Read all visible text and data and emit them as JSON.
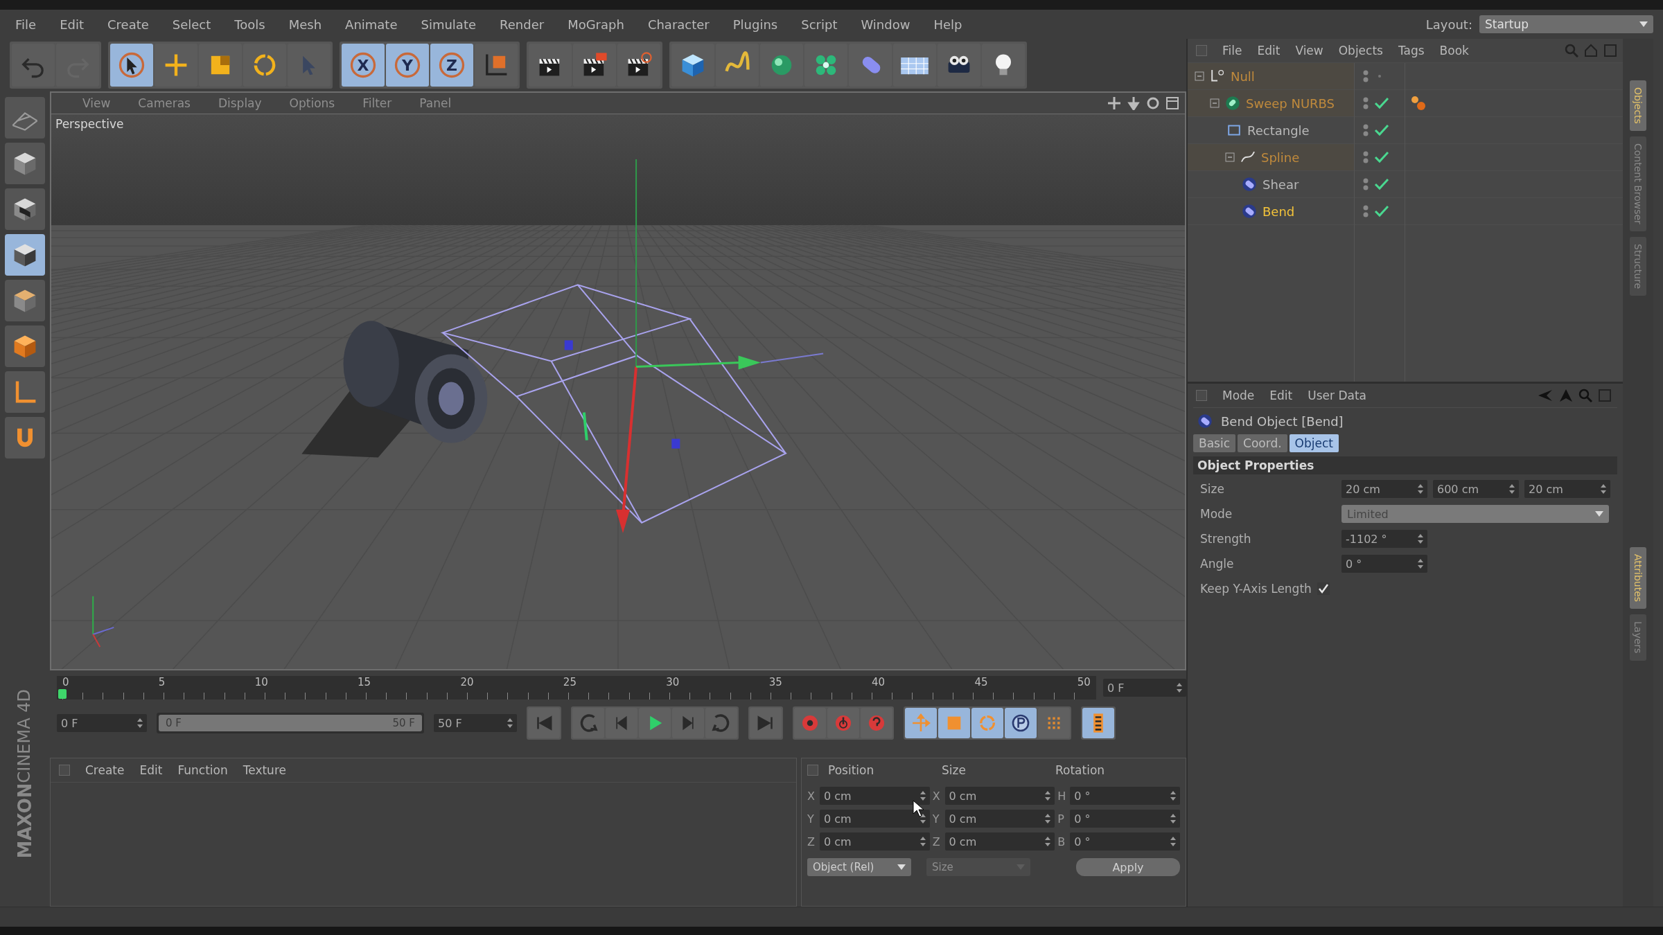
{
  "menu_bar": {
    "items": [
      "File",
      "Edit",
      "Create",
      "Select",
      "Tools",
      "Mesh",
      "Animate",
      "Simulate",
      "Render",
      "MoGraph",
      "Character",
      "Plugins",
      "Script",
      "Window",
      "Help"
    ],
    "layout_label": "Layout:",
    "layout_value": "Startup"
  },
  "toolbar_groups": [
    [
      {
        "kind": "undo",
        "selected": false
      },
      {
        "kind": "redo",
        "selected": false
      }
    ],
    [
      {
        "kind": "live-selection",
        "selected": true
      },
      {
        "kind": "move",
        "selected": false
      },
      {
        "kind": "scale",
        "selected": false
      },
      {
        "kind": "rotate",
        "selected": false
      },
      {
        "kind": "last-tool",
        "selected": false
      }
    ],
    [
      {
        "kind": "axis",
        "label": "X",
        "selected": true
      },
      {
        "kind": "axis",
        "label": "Y",
        "selected": true
      },
      {
        "kind": "axis",
        "label": "Z",
        "selected": true
      },
      {
        "kind": "coordinate-system",
        "selected": false
      }
    ],
    [
      {
        "kind": "render-view",
        "selected": false
      },
      {
        "kind": "render-picture",
        "selected": false
      },
      {
        "kind": "render-settings",
        "selected": false
      }
    ],
    [
      {
        "kind": "cube",
        "selected": false
      },
      {
        "kind": "spline",
        "selected": false
      },
      {
        "kind": "nurbs",
        "selected": false
      },
      {
        "kind": "array",
        "selected": false
      },
      {
        "kind": "deformer",
        "selected": false
      },
      {
        "kind": "floor",
        "selected": false
      },
      {
        "kind": "camera",
        "selected": false
      },
      {
        "kind": "light",
        "selected": false
      }
    ]
  ],
  "left_tools": [
    {
      "kind": "grid",
      "selected": false
    },
    {
      "kind": "model",
      "selected": false
    },
    {
      "kind": "texture",
      "selected": false
    },
    {
      "kind": "object",
      "selected": true
    },
    {
      "kind": "edges",
      "selected": false
    },
    {
      "kind": "polygons",
      "selected": false
    },
    {
      "kind": "axis",
      "selected": false
    },
    {
      "kind": "snap",
      "selected": false
    }
  ],
  "logo": {
    "line_1": "MAXON",
    "line_2": "CINEMA 4D"
  },
  "viewport": {
    "menu": [
      "View",
      "Cameras",
      "Display",
      "Options",
      "Filter",
      "Panel"
    ],
    "camera_label": "Perspective"
  },
  "timeline": {
    "ticks": [
      "0",
      "5",
      "10",
      "15",
      "20",
      "25",
      "30",
      "35",
      "40",
      "45",
      "50"
    ],
    "level": 0,
    "current_frame": "0 F",
    "start_field": "0 F",
    "range": {
      "level": 1,
      "start": "0 F",
      "end": "50 F"
    },
    "end_field": "50 F"
  },
  "transport_groups": [
    [
      {
        "kind": "first",
        "selected": false
      }
    ],
    [
      {
        "kind": "prev-key",
        "selected": false
      },
      {
        "kind": "prev-frame",
        "selected": false
      },
      {
        "kind": "play",
        "selected": false
      },
      {
        "kind": "next-frame",
        "selected": false
      },
      {
        "kind": "next-key",
        "selected": false
      }
    ],
    [
      {
        "kind": "last",
        "selected": false
      }
    ],
    [
      {
        "kind": "record",
        "selected": false
      },
      {
        "kind": "autokey",
        "selected": false
      },
      {
        "kind": "key-selection",
        "selected": false
      }
    ],
    [
      {
        "kind": "key-move",
        "selected": true
      },
      {
        "kind": "key-scale",
        "selected": true
      },
      {
        "kind": "key-rotate",
        "selected": true
      },
      {
        "kind": "key-param",
        "selected": true
      },
      {
        "kind": "key-points",
        "selected": false
      }
    ],
    [
      {
        "kind": "timeline",
        "selected": true
      }
    ]
  ],
  "material_manager": {
    "menu": [
      "Create",
      "Edit",
      "Function",
      "Texture"
    ]
  },
  "coordinates": {
    "headers": [
      "Position",
      "Size",
      "Rotation"
    ],
    "rows": [
      {
        "axis": "X",
        "position": "0 cm",
        "size_axis": "X",
        "size": "0 cm",
        "rotation_axis": "H",
        "rotation": "0 °"
      },
      {
        "axis": "Y",
        "position": "0 cm",
        "size_axis": "Y",
        "size": "0 cm",
        "rotation_axis": "P",
        "rotation": "0 °"
      },
      {
        "axis": "Z",
        "position": "0 cm",
        "size_axis": "Z",
        "size": "0 cm",
        "rotation_axis": "B",
        "rotation": "0 °"
      }
    ],
    "mode": "Object (Rel)",
    "size_mode": "Size",
    "size_mode_disabled": true,
    "apply": "Apply"
  },
  "object_manager": {
    "menu": [
      "File",
      "Edit",
      "View",
      "Objects",
      "Tags",
      "Book"
    ],
    "objects": [
      {
        "name": "Null",
        "kind": "null",
        "selected": false,
        "highlighted": true,
        "expanded": true,
        "checked": false,
        "children": [
          {
            "name": "Sweep NURBS",
            "kind": "sweep",
            "selected": false,
            "highlighted": true,
            "expanded": true,
            "checked": true,
            "tags": [
              {
                "kind": "phong"
              }
            ],
            "children": [
              {
                "name": "Rectangle",
                "kind": "rectangle",
                "selected": false,
                "highlighted": false,
                "checked": true
              },
              {
                "name": "Spline",
                "kind": "spline",
                "selected": false,
                "highlighted": true,
                "expanded": true,
                "checked": true,
                "children": [
                  {
                    "name": "Shear",
                    "kind": "deformer",
                    "selected": false,
                    "highlighted": false,
                    "checked": true
                  },
                  {
                    "name": "Bend",
                    "kind": "deformer",
                    "selected": true,
                    "highlighted": false,
                    "checked": true
                  }
                ]
              }
            ]
          }
        ]
      }
    ]
  },
  "attribute_manager": {
    "menu": [
      "Mode",
      "Edit",
      "User Data"
    ],
    "object_title": "Bend Object [Bend]",
    "tabs": [
      {
        "label": "Basic",
        "selected": false
      },
      {
        "label": "Coord.",
        "selected": false
      },
      {
        "label": "Object",
        "selected": true
      }
    ],
    "section": "Object Properties",
    "properties": [
      {
        "kind": "vector",
        "label": "Size",
        "values": [
          "20 cm",
          "600 cm",
          "20 cm"
        ]
      },
      {
        "kind": "dropdown",
        "label": "Mode",
        "value": "Limited"
      },
      {
        "kind": "number",
        "label": "Strength",
        "value": "-1102 °"
      },
      {
        "kind": "number",
        "label": "Angle",
        "value": "0 °"
      },
      {
        "kind": "checkbox",
        "label": "Keep Y-Axis Length",
        "checked": true
      }
    ]
  },
  "side_tabs": {
    "top": [
      {
        "label": "Objects",
        "selected": true
      },
      {
        "label": "Content Browser",
        "selected": false
      },
      {
        "label": "Structure",
        "selected": false
      }
    ],
    "bottom": [
      {
        "label": "Attributes",
        "selected": true
      },
      {
        "label": "Layers",
        "selected": false
      }
    ]
  }
}
